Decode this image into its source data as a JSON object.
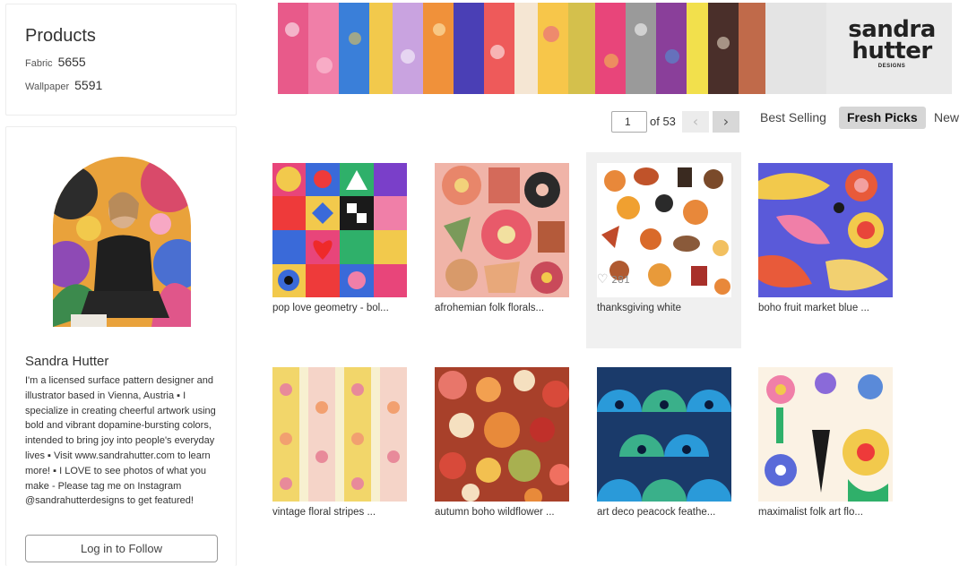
{
  "products": {
    "title": "Products",
    "fabric": {
      "label": "Fabric",
      "count": "5655"
    },
    "wallpaper": {
      "label": "Wallpaper",
      "count": "5591"
    }
  },
  "designer": {
    "name": "Sandra Hutter",
    "bio": "I'm a licensed surface pattern designer and illustrator based in Vienna, Austria ▪ I specialize in creating cheerful artwork using bold and vibrant dopamine-bursting colors, intended to bring joy into people's everyday lives ▪ Visit www.sandrahutter.com to learn more! ▪ I LOVE to see photos of what you make - Please tag me on Instagram @sandrahutterdesigns to get featured!",
    "follow_label": "Log in to Follow"
  },
  "banner": {
    "logo_line1": "sandra",
    "logo_line2": "hutter",
    "logo_sub": "DESIGNS"
  },
  "pager": {
    "current": "1",
    "of_label": "of 53",
    "prev": "‹",
    "next": "›"
  },
  "sort": {
    "best": "Best Selling",
    "fresh": "Fresh Picks",
    "new": "New"
  },
  "grid": [
    {
      "name": "pop love geometry - bol..."
    },
    {
      "name": "afrohemian folk florals..."
    },
    {
      "name": "thanksgiving white",
      "favorites": "281"
    },
    {
      "name": "boho fruit market blue ..."
    },
    {
      "name": "vintage floral stripes ..."
    },
    {
      "name": "autumn boho wildflower ..."
    },
    {
      "name": "art deco peacock feathe..."
    },
    {
      "name": "maximalist folk art flo..."
    }
  ],
  "colors": {
    "accent_active_sort": "#d6d6d6",
    "logo_pink": "#e8457a",
    "logo_green": "#2fb06a"
  }
}
